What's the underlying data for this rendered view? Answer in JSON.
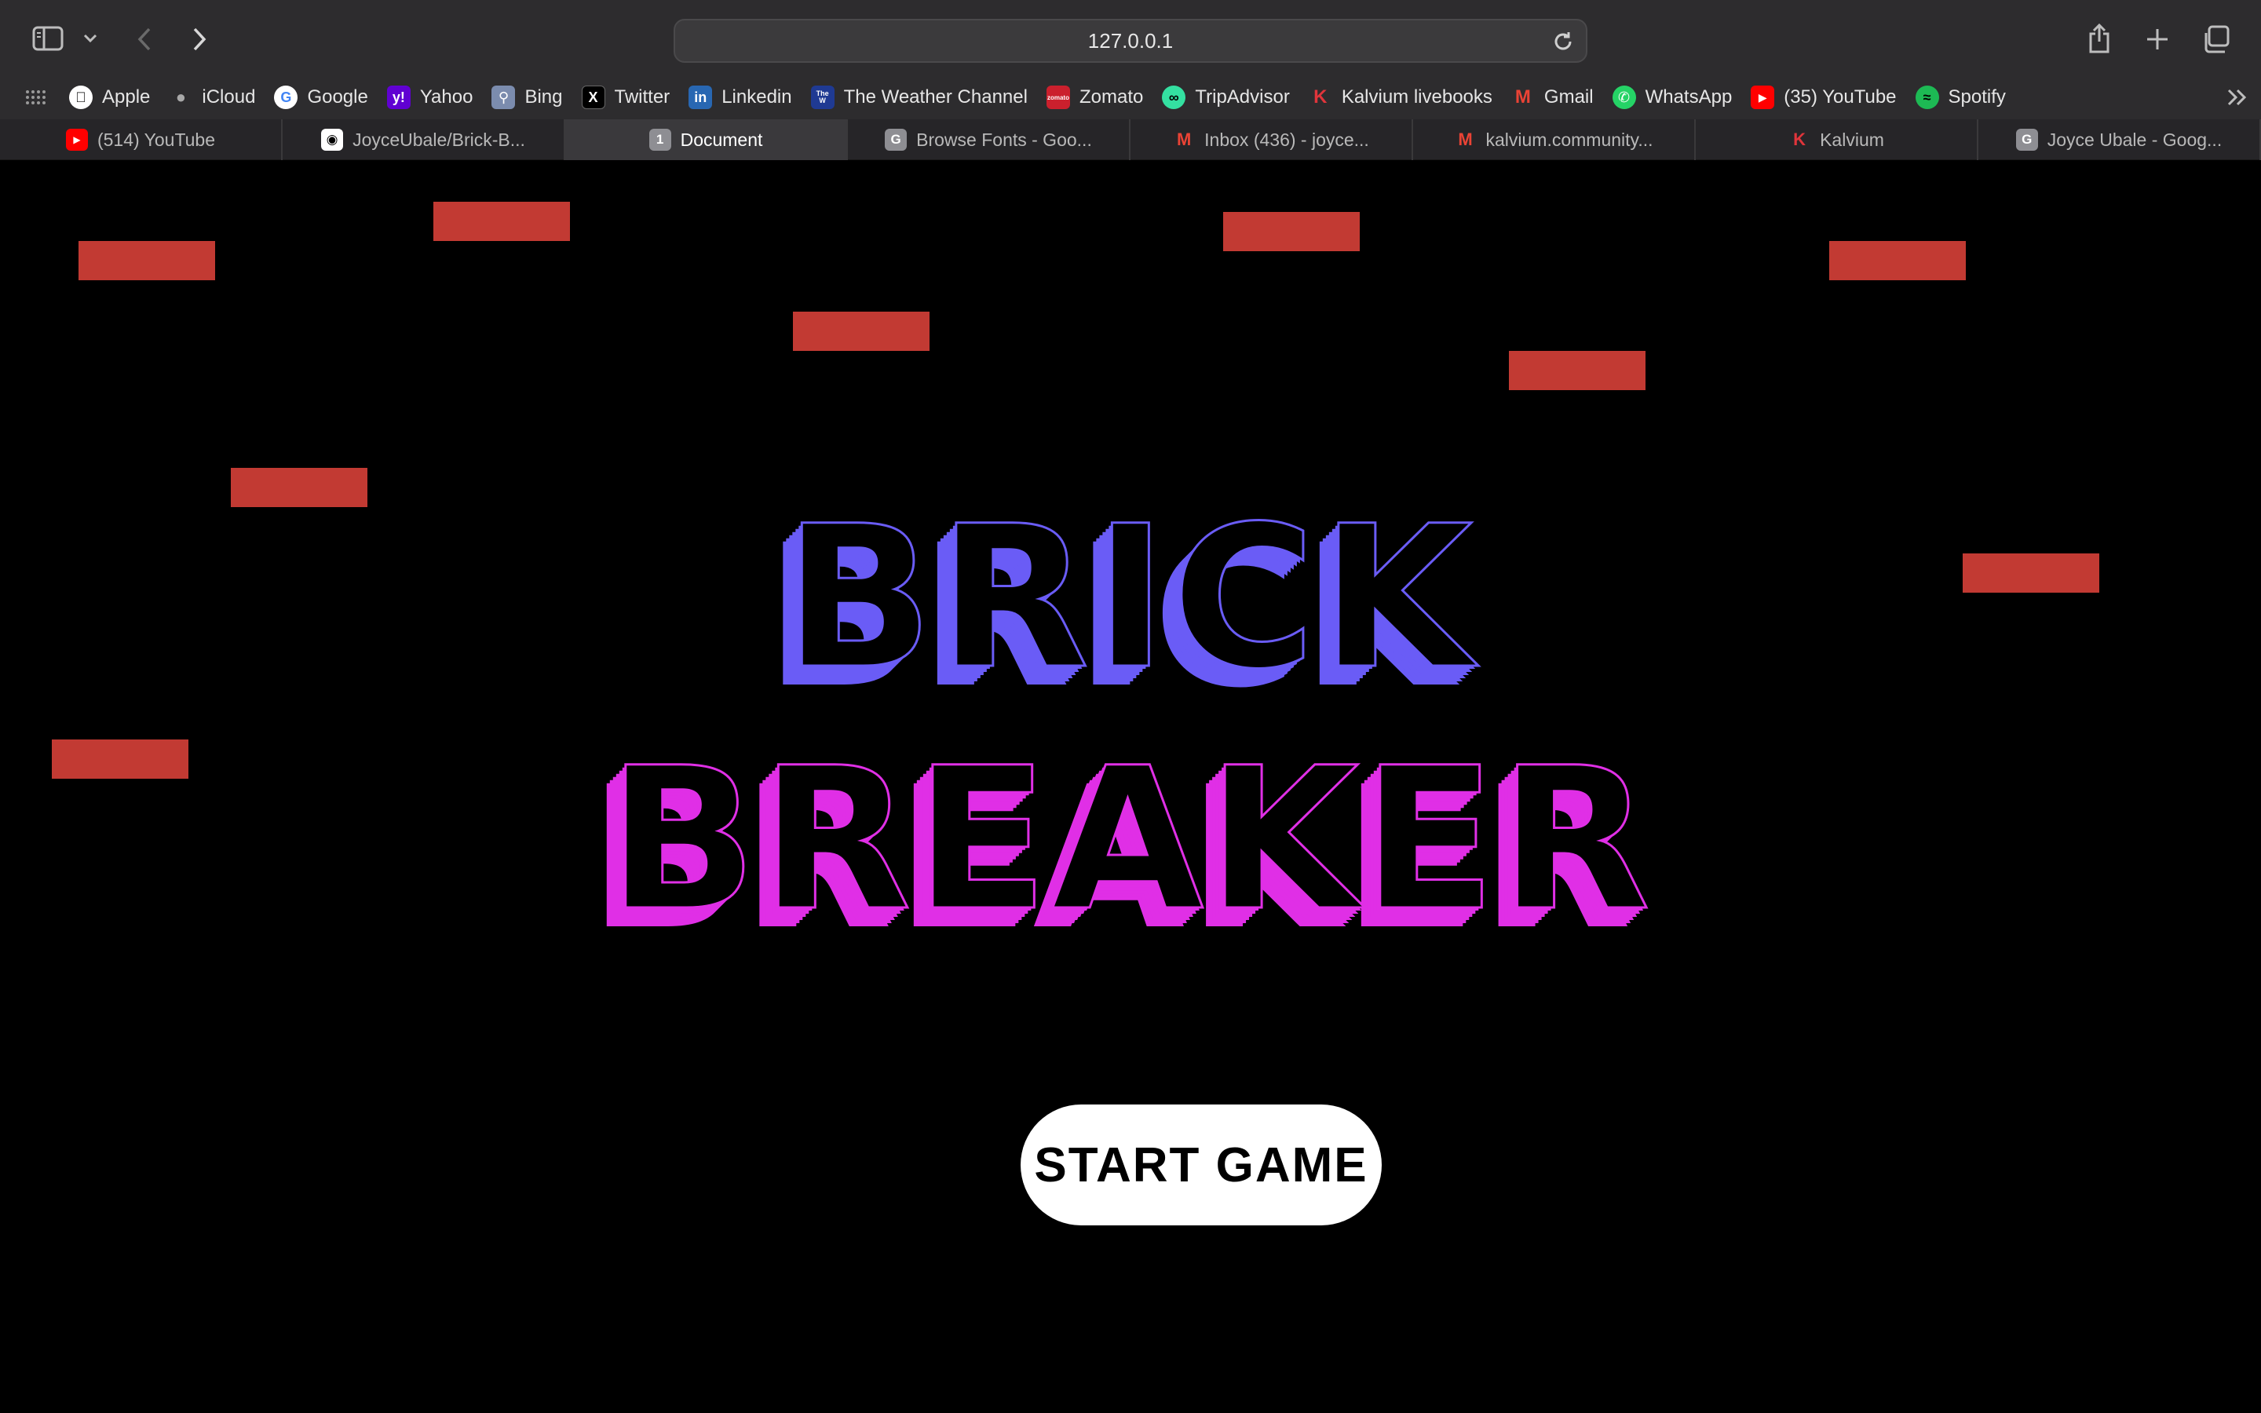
{
  "browser": {
    "url": "127.0.0.1",
    "bookmarks": [
      {
        "label": "Apple",
        "icon": "apple-icon",
        "color": "#ffffff"
      },
      {
        "label": "iCloud",
        "icon": "apple-icon",
        "color": "#a8a8a8"
      },
      {
        "label": "Google",
        "icon": "google-icon",
        "color": "#ffffff"
      },
      {
        "label": "Yahoo",
        "icon": "yahoo-icon",
        "color": "#6001d2"
      },
      {
        "label": "Bing",
        "icon": "bing-icon",
        "color": "#5a6a8a"
      },
      {
        "label": "Twitter",
        "icon": "x-icon",
        "color": "#000000"
      },
      {
        "label": "Linkedin",
        "icon": "linkedin-icon",
        "color": "#2867b2"
      },
      {
        "label": "The Weather Channel",
        "icon": "weather-channel-icon",
        "color": "#1f3a93"
      },
      {
        "label": "Zomato",
        "icon": "zomato-icon",
        "color": "#cb202d"
      },
      {
        "label": "TripAdvisor",
        "icon": "tripadvisor-icon",
        "color": "#34e0a1"
      },
      {
        "label": "Kalvium livebooks",
        "icon": "kalvium-icon",
        "color": "#e0353b"
      },
      {
        "label": "Gmail",
        "icon": "gmail-icon",
        "color": "#ea4335"
      },
      {
        "label": "WhatsApp",
        "icon": "whatsapp-icon",
        "color": "#25d366"
      },
      {
        "label": "(35) YouTube",
        "icon": "youtube-icon",
        "color": "#ff0000"
      },
      {
        "label": "Spotify",
        "icon": "spotify-icon",
        "color": "#1db954"
      }
    ],
    "tabs": [
      {
        "label": "(514) YouTube",
        "icon": "youtube-icon",
        "color": "#ff0000",
        "active": false
      },
      {
        "label": "JoyceUbale/Brick-B...",
        "icon": "github-icon",
        "color": "#ffffff",
        "active": false
      },
      {
        "label": "Document",
        "icon": "1",
        "color": "#8e8e93",
        "active": true
      },
      {
        "label": "Browse Fonts - Goo...",
        "icon": "G",
        "color": "#8e8e93",
        "active": false
      },
      {
        "label": "Inbox (436) - joyce...",
        "icon": "gmail-icon",
        "color": "#ea4335",
        "active": false
      },
      {
        "label": "kalvium.community...",
        "icon": "gmail-icon",
        "color": "#ea4335",
        "active": false
      },
      {
        "label": "Kalvium",
        "icon": "kalvium-icon",
        "color": "#e0353b",
        "active": false
      },
      {
        "label": "Joyce Ubale - Goog...",
        "icon": "G",
        "color": "#8e8e93",
        "active": false
      }
    ]
  },
  "game": {
    "title_line1": "BRICK",
    "title_line2": "BREAKER",
    "start_button": "START GAME",
    "colors": {
      "title1": "#6a5cf6",
      "title2": "#e02fe6",
      "brick": "#c23a33",
      "background": "#000000"
    }
  }
}
